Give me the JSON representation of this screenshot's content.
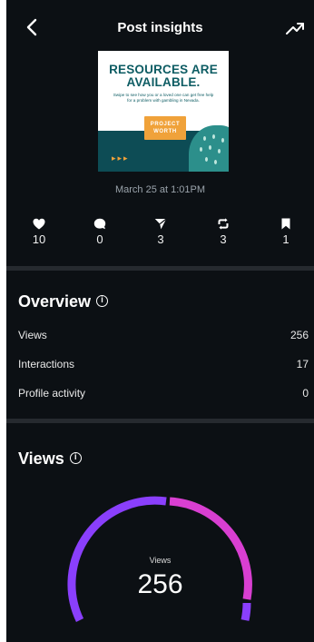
{
  "header": {
    "title": "Post insights"
  },
  "post": {
    "thumbnail": {
      "headline_line1": "RESOURCES ARE",
      "headline_line2": "AVAILABLE.",
      "subtext": "Swipe to see how you or a loved one can get free help for a problem with gambling in Nevada.",
      "badge_line1": "PROJECT",
      "badge_line2": "WORTH",
      "arrows": "▸▸▸"
    },
    "date": "March 25 at 1:01PM"
  },
  "stats": [
    {
      "icon": "heart-icon",
      "value": "10"
    },
    {
      "icon": "comment-icon",
      "value": "0"
    },
    {
      "icon": "share-icon",
      "value": "3"
    },
    {
      "icon": "repost-icon",
      "value": "3"
    },
    {
      "icon": "bookmark-icon",
      "value": "1"
    }
  ],
  "overview": {
    "title": "Overview",
    "rows": [
      {
        "label": "Views",
        "value": "256"
      },
      {
        "label": "Interactions",
        "value": "17"
      },
      {
        "label": "Profile activity",
        "value": "0"
      }
    ]
  },
  "views": {
    "title": "Views",
    "gauge_label": "Views",
    "gauge_value": "256",
    "colors": {
      "followers": "#8a3ffc",
      "non_followers": "#d93fd1"
    }
  }
}
